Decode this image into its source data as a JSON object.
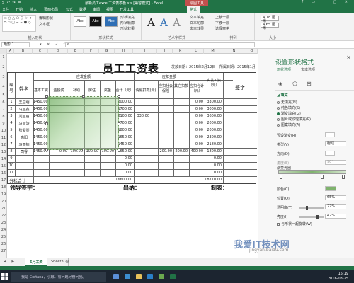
{
  "window": {
    "quick_access": "S ↶ ↷ =",
    "title": "最新员工excel工资表模板.xls [兼容模式] - Excel",
    "context_tab": "绘图工具",
    "controls": "? ▭ _ ▢ ✕"
  },
  "ribbon_tabs": [
    "文件",
    "开始",
    "插入",
    "页面布局",
    "公式",
    "数据",
    "审阅",
    "视图",
    "开发工具",
    "格式"
  ],
  "active_tab_index": 9,
  "ribbon": {
    "insert_shapes_label": "插入形状",
    "shapes_glyphs": "▭ ○ △ ⬠ ⬡ ☆ ➔ ⬭ ▱ ▢ ⌒ ⌓ ⬟ ◇",
    "edit_shape": "编辑形状",
    "text_box": "文本框",
    "shape_styles_label": "形状样式",
    "style_buttons": [
      "Abc",
      "Abc",
      "Abc"
    ],
    "shape_fill": "形状填充",
    "shape_outline": "形状轮廓",
    "shape_effects": "形状效果",
    "wordart_label": "艺术字样式",
    "wordart_glyphs": [
      "A",
      "A",
      "A"
    ],
    "text_fill": "文本填充",
    "text_outline": "文本轮廓",
    "text_effects": "文本效果",
    "arrange": [
      "上移一层",
      "下移一层",
      "选择窗格"
    ],
    "arrange_label": "排列",
    "size_height": "4.18 厘米",
    "size_width": "4.65 厘米",
    "size_label": "大小"
  },
  "formula_bar": {
    "name_box": "矩形 1",
    "icons": "▾ ✕ ✓ fx",
    "value": ""
  },
  "columns": [
    "A",
    "B",
    "C",
    "D",
    "E",
    "F",
    "G",
    "H",
    "I",
    "J",
    "K",
    "L",
    "M",
    "N",
    "O"
  ],
  "rows": [
    "1",
    "2",
    "3",
    "4",
    "5",
    "6",
    "7",
    "8",
    "9",
    "10",
    "11",
    "12",
    "13",
    "14",
    "15",
    "16",
    "17",
    "18",
    "19",
    "20",
    "21",
    "22",
    "23",
    "24",
    "25",
    "26",
    "27"
  ],
  "sheet": {
    "title": "员工工资表",
    "issue_date": "发放日期：2015年2月12日",
    "period": "所属日期：2015年1月",
    "h_no": "编号",
    "h_name": "姓名",
    "h_payable": "应发金额",
    "h_deduct": "应扣金额",
    "h_actual": "实发工资（元）",
    "h_sign": "签字",
    "h_basic": "基本工资",
    "h_seniority": "金龄奖",
    "h_allowance": "补助",
    "h_housing": "房住",
    "h_bonus": "奖金",
    "h_total": "合计（元）",
    "h_late": "请假扣款(元)",
    "h_social_pension": "应扣社会保险",
    "h_social_other": "其它扣款",
    "h_deduct_total": "应扣合计（元）",
    "subtotal": "分栏合计",
    "footer_leader": "领导签字：",
    "footer_cashier": "出纳：",
    "footer_maker": "制表："
  },
  "table_rows": [
    {
      "no": "1",
      "name": "王立明",
      "basic": "1450.00",
      "bonus": "",
      "total": "2000.00",
      "late": "",
      "dp": "",
      "do": "",
      "dt": "0.00",
      "actual": "3300.00"
    },
    {
      "no": "2",
      "name": "马亚鑫",
      "basic": "1450.00",
      "bonus": "",
      "total": "1700.00",
      "late": "",
      "dp": "",
      "do": "",
      "dt": "0.00",
      "actual": "3000.00"
    },
    {
      "no": "3",
      "name": "刘亚丽",
      "basic": "1450.00",
      "bonus": "",
      "total": "2100.00",
      "late": "330.00",
      "dp": "",
      "do": "",
      "dt": "0.00",
      "actual": "3600.00"
    },
    {
      "no": "4",
      "name": "马亚涛",
      "basic": "1450.00",
      "bonus": "",
      "total": "1700.00",
      "late": "",
      "dp": "",
      "do": "",
      "dt": "0.00",
      "actual": "2000.00"
    },
    {
      "no": "5",
      "name": "张爱琴",
      "basic": "1450.00",
      "bonus": "",
      "total": "1800.00",
      "late": "",
      "dp": "",
      "do": "",
      "dt": "0.00",
      "actual": "2000.00"
    },
    {
      "no": "6",
      "name": "高阳",
      "basic": "1450.00",
      "bonus": "",
      "total": "1650.00",
      "late": "",
      "dp": "",
      "do": "",
      "dt": "0.00",
      "actual": "2300.00"
    },
    {
      "no": "7",
      "name": "马亚楠",
      "basic": "1450.00",
      "bonus": "",
      "total": "1450.00",
      "late": "",
      "dp": "",
      "do": "",
      "dt": "0.00",
      "actual": "2180.00"
    },
    {
      "no": "8",
      "name": "司睿",
      "basic": "1450.00",
      "bonus": "100.00",
      "total": "1650.00",
      "late": "",
      "dp": "200.00",
      "do": "200.00",
      "dt": "400.00",
      "actual": "1800.00"
    },
    {
      "no": "9",
      "name": "",
      "basic": "",
      "bonus": "",
      "total": "0.00",
      "late": "",
      "dp": "",
      "do": "",
      "dt": "",
      "actual": "0.00"
    },
    {
      "no": "10",
      "name": "",
      "basic": "",
      "bonus": "",
      "total": "0.00",
      "late": "",
      "dp": "",
      "do": "",
      "dt": "",
      "actual": "0.00"
    },
    {
      "no": "11",
      "name": "",
      "basic": "",
      "bonus": "",
      "total": "0.00",
      "late": "",
      "dp": "",
      "do": "",
      "dt": "",
      "actual": "0.00"
    }
  ],
  "row8_extra": {
    "seniority": "0.00",
    "allowance": "100.00",
    "housing": "100.00"
  },
  "subtotals": {
    "total": "16600.00",
    "actual": "18770.00"
  },
  "sheet_tabs": [
    "5月工资",
    "Sheet3"
  ],
  "panel": {
    "title": "设置形状格式",
    "close": "✕",
    "tab_shape": "形状选项",
    "tab_text": "文本选项",
    "section_fill": "◢ 填充",
    "fill_options": [
      "无填充(N)",
      "纯色填充(S)",
      "渐变填充(G)",
      "图片或纹理填充(P)",
      "图案填充(A)"
    ],
    "fill_selected": 2,
    "preset": "预设渐变(R)",
    "type": "类型(Y)",
    "type_value": "射线",
    "direction": "方向(D)",
    "angle": "角度(E)",
    "angle_value": "90°",
    "stops": "渐变光圈",
    "color": "颜色(C)",
    "position": "位置(O)",
    "position_value": "65%",
    "transparency": "透明度(T)",
    "transparency_value": "27%",
    "brightness": "亮度(I)",
    "brightness_value": "42%",
    "rotate_with_shape": "与形状一起旋转(W)"
  },
  "taskbar": {
    "cortana": "我是 Cortana，小娜。有问题尽管问我。",
    "time": "15:19",
    "date": "2016-03-25"
  },
  "watermark": {
    "line1": "我爱IT技术网",
    "line2": "jingyan.baidu.com"
  },
  "colors": {
    "excel_green": "#217346",
    "context_red": "#c0504d"
  }
}
